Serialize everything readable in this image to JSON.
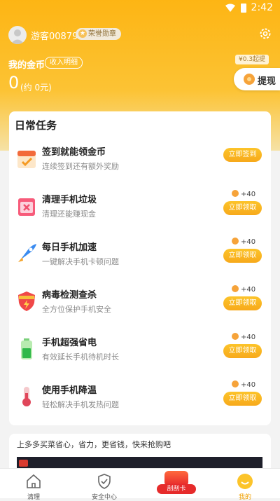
{
  "status_bar": {
    "time": "2:42"
  },
  "profile": {
    "username": "游客008796",
    "badge": "荣誉勋章"
  },
  "coins": {
    "title": "我的金币",
    "income_detail": "收入明细",
    "value": "0",
    "yuan": "(约 0元)",
    "withdraw_min": "¥0.3起提",
    "withdraw_label": "提现"
  },
  "tasks": {
    "title": "日常任务",
    "items": [
      {
        "name": "签到就能领金币",
        "desc": "连续签到还有额外奖励",
        "reward": "",
        "action": "立即签到",
        "icon": "calendar-icon"
      },
      {
        "name": "清理手机垃圾",
        "desc": "清理还能赚现金",
        "reward": "+40",
        "action": "立即领取",
        "icon": "trash-icon"
      },
      {
        "name": "每日手机加速",
        "desc": "一键解决手机卡顿问题",
        "reward": "+40",
        "action": "立即领取",
        "icon": "rocket-icon"
      },
      {
        "name": "病毒检测查杀",
        "desc": "全方位保护手机安全",
        "reward": "+40",
        "action": "立即领取",
        "icon": "shield-icon"
      },
      {
        "name": "手机超强省电",
        "desc": "有效延长手机待机时长",
        "reward": "+40",
        "action": "立即领取",
        "icon": "battery-icon"
      },
      {
        "name": "使用手机降温",
        "desc": "轻松解决手机发热问题",
        "reward": "+40",
        "action": "立即领取",
        "icon": "thermometer-icon"
      }
    ]
  },
  "promo": {
    "text": "上多多买菜省心，省力，更省钱，快来抢购吧"
  },
  "nav": {
    "items": [
      {
        "label": "清理",
        "icon": "home-icon"
      },
      {
        "label": "安全中心",
        "icon": "shield-check-icon"
      },
      {
        "label": "刮刮卡",
        "icon": "scratch-card-icon"
      },
      {
        "label": "我的",
        "icon": "profile-icon"
      }
    ]
  },
  "colors": {
    "accent": "#fdb514",
    "button": "#f7a91b",
    "active": "#f0a000"
  }
}
